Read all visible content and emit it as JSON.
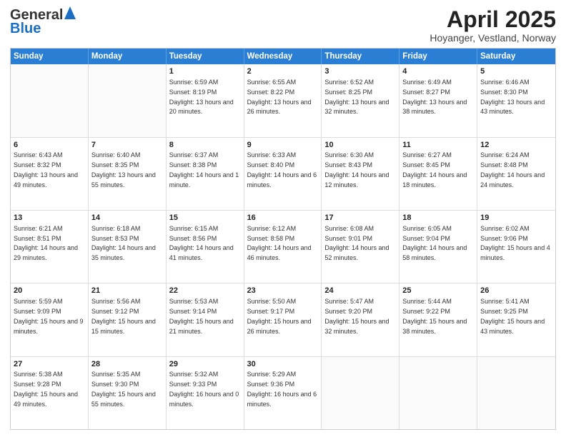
{
  "header": {
    "logo_general": "General",
    "logo_blue": "Blue",
    "title": "April 2025",
    "location": "Hoyanger, Vestland, Norway"
  },
  "weekdays": [
    "Sunday",
    "Monday",
    "Tuesday",
    "Wednesday",
    "Thursday",
    "Friday",
    "Saturday"
  ],
  "weeks": [
    [
      {
        "day": "",
        "sunrise": "",
        "sunset": "",
        "daylight": "",
        "empty": true
      },
      {
        "day": "",
        "sunrise": "",
        "sunset": "",
        "daylight": "",
        "empty": true
      },
      {
        "day": "1",
        "sunrise": "Sunrise: 6:59 AM",
        "sunset": "Sunset: 8:19 PM",
        "daylight": "Daylight: 13 hours and 20 minutes.",
        "empty": false
      },
      {
        "day": "2",
        "sunrise": "Sunrise: 6:55 AM",
        "sunset": "Sunset: 8:22 PM",
        "daylight": "Daylight: 13 hours and 26 minutes.",
        "empty": false
      },
      {
        "day": "3",
        "sunrise": "Sunrise: 6:52 AM",
        "sunset": "Sunset: 8:25 PM",
        "daylight": "Daylight: 13 hours and 32 minutes.",
        "empty": false
      },
      {
        "day": "4",
        "sunrise": "Sunrise: 6:49 AM",
        "sunset": "Sunset: 8:27 PM",
        "daylight": "Daylight: 13 hours and 38 minutes.",
        "empty": false
      },
      {
        "day": "5",
        "sunrise": "Sunrise: 6:46 AM",
        "sunset": "Sunset: 8:30 PM",
        "daylight": "Daylight: 13 hours and 43 minutes.",
        "empty": false
      }
    ],
    [
      {
        "day": "6",
        "sunrise": "Sunrise: 6:43 AM",
        "sunset": "Sunset: 8:32 PM",
        "daylight": "Daylight: 13 hours and 49 minutes.",
        "empty": false
      },
      {
        "day": "7",
        "sunrise": "Sunrise: 6:40 AM",
        "sunset": "Sunset: 8:35 PM",
        "daylight": "Daylight: 13 hours and 55 minutes.",
        "empty": false
      },
      {
        "day": "8",
        "sunrise": "Sunrise: 6:37 AM",
        "sunset": "Sunset: 8:38 PM",
        "daylight": "Daylight: 14 hours and 1 minute.",
        "empty": false
      },
      {
        "day": "9",
        "sunrise": "Sunrise: 6:33 AM",
        "sunset": "Sunset: 8:40 PM",
        "daylight": "Daylight: 14 hours and 6 minutes.",
        "empty": false
      },
      {
        "day": "10",
        "sunrise": "Sunrise: 6:30 AM",
        "sunset": "Sunset: 8:43 PM",
        "daylight": "Daylight: 14 hours and 12 minutes.",
        "empty": false
      },
      {
        "day": "11",
        "sunrise": "Sunrise: 6:27 AM",
        "sunset": "Sunset: 8:45 PM",
        "daylight": "Daylight: 14 hours and 18 minutes.",
        "empty": false
      },
      {
        "day": "12",
        "sunrise": "Sunrise: 6:24 AM",
        "sunset": "Sunset: 8:48 PM",
        "daylight": "Daylight: 14 hours and 24 minutes.",
        "empty": false
      }
    ],
    [
      {
        "day": "13",
        "sunrise": "Sunrise: 6:21 AM",
        "sunset": "Sunset: 8:51 PM",
        "daylight": "Daylight: 14 hours and 29 minutes.",
        "empty": false
      },
      {
        "day": "14",
        "sunrise": "Sunrise: 6:18 AM",
        "sunset": "Sunset: 8:53 PM",
        "daylight": "Daylight: 14 hours and 35 minutes.",
        "empty": false
      },
      {
        "day": "15",
        "sunrise": "Sunrise: 6:15 AM",
        "sunset": "Sunset: 8:56 PM",
        "daylight": "Daylight: 14 hours and 41 minutes.",
        "empty": false
      },
      {
        "day": "16",
        "sunrise": "Sunrise: 6:12 AM",
        "sunset": "Sunset: 8:58 PM",
        "daylight": "Daylight: 14 hours and 46 minutes.",
        "empty": false
      },
      {
        "day": "17",
        "sunrise": "Sunrise: 6:08 AM",
        "sunset": "Sunset: 9:01 PM",
        "daylight": "Daylight: 14 hours and 52 minutes.",
        "empty": false
      },
      {
        "day": "18",
        "sunrise": "Sunrise: 6:05 AM",
        "sunset": "Sunset: 9:04 PM",
        "daylight": "Daylight: 14 hours and 58 minutes.",
        "empty": false
      },
      {
        "day": "19",
        "sunrise": "Sunrise: 6:02 AM",
        "sunset": "Sunset: 9:06 PM",
        "daylight": "Daylight: 15 hours and 4 minutes.",
        "empty": false
      }
    ],
    [
      {
        "day": "20",
        "sunrise": "Sunrise: 5:59 AM",
        "sunset": "Sunset: 9:09 PM",
        "daylight": "Daylight: 15 hours and 9 minutes.",
        "empty": false
      },
      {
        "day": "21",
        "sunrise": "Sunrise: 5:56 AM",
        "sunset": "Sunset: 9:12 PM",
        "daylight": "Daylight: 15 hours and 15 minutes.",
        "empty": false
      },
      {
        "day": "22",
        "sunrise": "Sunrise: 5:53 AM",
        "sunset": "Sunset: 9:14 PM",
        "daylight": "Daylight: 15 hours and 21 minutes.",
        "empty": false
      },
      {
        "day": "23",
        "sunrise": "Sunrise: 5:50 AM",
        "sunset": "Sunset: 9:17 PM",
        "daylight": "Daylight: 15 hours and 26 minutes.",
        "empty": false
      },
      {
        "day": "24",
        "sunrise": "Sunrise: 5:47 AM",
        "sunset": "Sunset: 9:20 PM",
        "daylight": "Daylight: 15 hours and 32 minutes.",
        "empty": false
      },
      {
        "day": "25",
        "sunrise": "Sunrise: 5:44 AM",
        "sunset": "Sunset: 9:22 PM",
        "daylight": "Daylight: 15 hours and 38 minutes.",
        "empty": false
      },
      {
        "day": "26",
        "sunrise": "Sunrise: 5:41 AM",
        "sunset": "Sunset: 9:25 PM",
        "daylight": "Daylight: 15 hours and 43 minutes.",
        "empty": false
      }
    ],
    [
      {
        "day": "27",
        "sunrise": "Sunrise: 5:38 AM",
        "sunset": "Sunset: 9:28 PM",
        "daylight": "Daylight: 15 hours and 49 minutes.",
        "empty": false
      },
      {
        "day": "28",
        "sunrise": "Sunrise: 5:35 AM",
        "sunset": "Sunset: 9:30 PM",
        "daylight": "Daylight: 15 hours and 55 minutes.",
        "empty": false
      },
      {
        "day": "29",
        "sunrise": "Sunrise: 5:32 AM",
        "sunset": "Sunset: 9:33 PM",
        "daylight": "Daylight: 16 hours and 0 minutes.",
        "empty": false
      },
      {
        "day": "30",
        "sunrise": "Sunrise: 5:29 AM",
        "sunset": "Sunset: 9:36 PM",
        "daylight": "Daylight: 16 hours and 6 minutes.",
        "empty": false
      },
      {
        "day": "",
        "sunrise": "",
        "sunset": "",
        "daylight": "",
        "empty": true
      },
      {
        "day": "",
        "sunrise": "",
        "sunset": "",
        "daylight": "",
        "empty": true
      },
      {
        "day": "",
        "sunrise": "",
        "sunset": "",
        "daylight": "",
        "empty": true
      }
    ]
  ]
}
